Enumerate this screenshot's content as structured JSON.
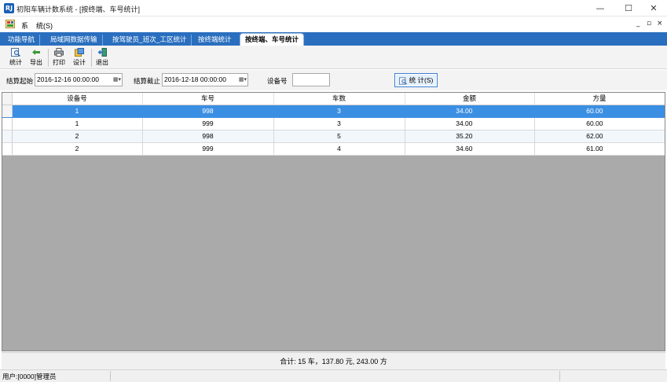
{
  "window": {
    "app_icon_text": "RJ",
    "title": "初阳车辆计数系统 - [按终端、车号统计]",
    "minimize": "—",
    "maximize": "☐",
    "close": "✕"
  },
  "menu": {
    "items": [
      "系",
      "统(S)"
    ],
    "mdi_controls": [
      "_",
      "▫",
      "×"
    ]
  },
  "tabs": [
    {
      "label": "功能导航",
      "active": false
    },
    {
      "label": "局域网数据传输",
      "active": false
    },
    {
      "label": "按驾驶员_班次_工区统计",
      "active": false
    },
    {
      "label": "按终端统计",
      "active": false
    },
    {
      "label": "按终端、车号统计",
      "active": true
    }
  ],
  "toolbar": {
    "stat": "统计",
    "export": "导出",
    "print": "打印",
    "design": "设计",
    "exit": "退出"
  },
  "filter": {
    "start_label": "结算起始",
    "start_value": "2016-12-16 00:00:00",
    "end_label": "结算截止",
    "end_value": "2016-12-18 00:00:00",
    "device_label": "设备号",
    "device_value": "",
    "stat_button": "统 计(S)"
  },
  "table": {
    "columns": [
      "设备号",
      "车号",
      "车数",
      "金额",
      "方量"
    ],
    "rows": [
      {
        "device": "1",
        "car": "998",
        "count": "3",
        "amount": "34.00",
        "volume": "60.00",
        "selected": true
      },
      {
        "device": "1",
        "car": "999",
        "count": "3",
        "amount": "34.00",
        "volume": "60.00",
        "selected": false
      },
      {
        "device": "2",
        "car": "998",
        "count": "5",
        "amount": "35.20",
        "volume": "62.00",
        "selected": false
      },
      {
        "device": "2",
        "car": "999",
        "count": "4",
        "amount": "34.60",
        "volume": "61.00",
        "selected": false
      }
    ]
  },
  "summary": "合计: 15 车，137.80 元, 243.00 方",
  "status": {
    "user": "用户:[0000]管理员"
  },
  "colors": {
    "tab_strip": "#2a6fbf",
    "selected_row": "#3b8fe3",
    "grid_empty": "#aaaaaa"
  }
}
